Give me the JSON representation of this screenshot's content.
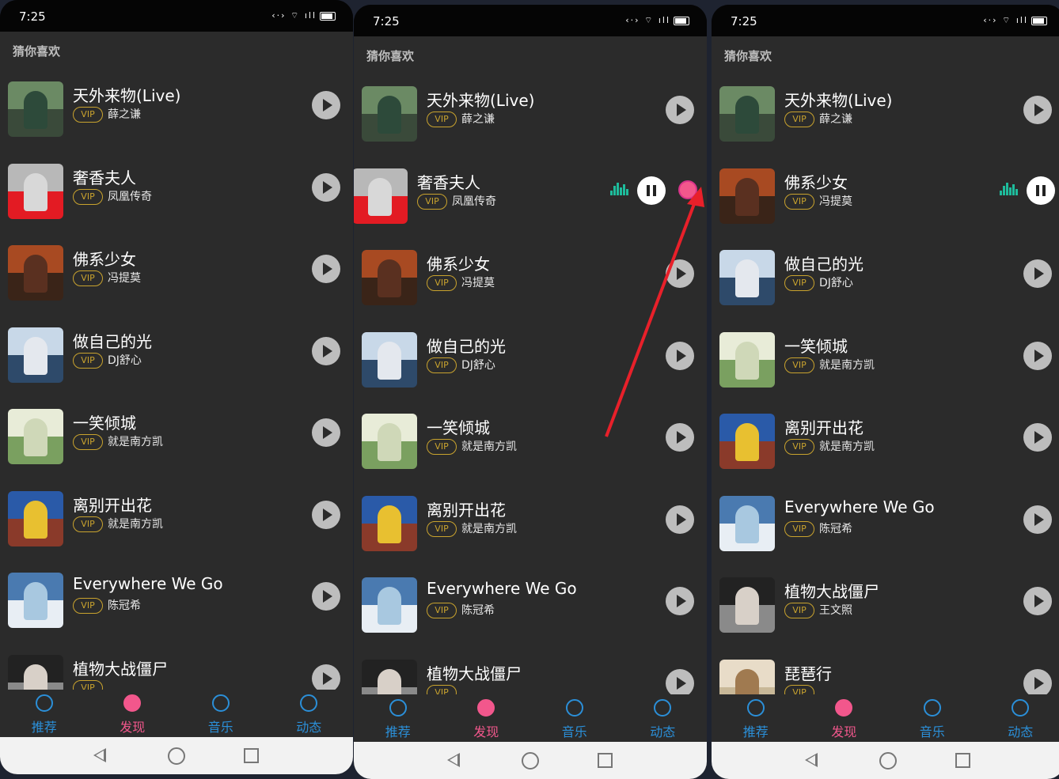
{
  "section_title": "猜你喜欢",
  "tabs": [
    {
      "label": "推荐",
      "icon": "thumbs-up-icon",
      "color": "#2b8fd8"
    },
    {
      "label": "发现",
      "icon": "discover-icon",
      "color": "#f2578c"
    },
    {
      "label": "音乐",
      "icon": "music-disc-icon",
      "color": "#2b8fd8"
    },
    {
      "label": "动态",
      "icon": "broadcast-icon",
      "color": "#2b8fd8"
    }
  ],
  "vip_label": "VIP",
  "colors": {
    "accent_vip": "#c9a32e",
    "playing_wave": "#1ebc9c",
    "tab_blue": "#2b8fd8",
    "tab_pink": "#f2578c",
    "list_bg": "#2b2b2b",
    "annotation_arrow": "#e8202a"
  },
  "screens": [
    {
      "time": "7:25",
      "songs": [
        {
          "title": "天外来物(Live)",
          "artist": "薛之谦",
          "state": "play"
        },
        {
          "title": "奢香夫人",
          "artist": "凤凰传奇",
          "state": "play"
        },
        {
          "title": "佛系少女",
          "artist": "冯提莫",
          "state": "play"
        },
        {
          "title": "做自己的光",
          "artist": "DJ舒心",
          "state": "play"
        },
        {
          "title": "一笑倾城",
          "artist": "就是南方凯",
          "state": "play"
        },
        {
          "title": "离别开出花",
          "artist": "就是南方凯",
          "state": "play"
        },
        {
          "title": "Everywhere We Go",
          "artist": "陈冠希",
          "state": "play"
        },
        {
          "title": "植物大战僵尸",
          "artist": "",
          "state": "play"
        }
      ]
    },
    {
      "time": "7:25",
      "songs": [
        {
          "title": "天外来物(Live)",
          "artist": "薛之谦",
          "state": "play"
        },
        {
          "title": "奢香夫人",
          "artist": "凤凰传奇",
          "state": "playing-swiped"
        },
        {
          "title": "佛系少女",
          "artist": "冯提莫",
          "state": "play"
        },
        {
          "title": "做自己的光",
          "artist": "DJ舒心",
          "state": "play"
        },
        {
          "title": "一笑倾城",
          "artist": "就是南方凯",
          "state": "play"
        },
        {
          "title": "离别开出花",
          "artist": "就是南方凯",
          "state": "play"
        },
        {
          "title": "Everywhere We Go",
          "artist": "陈冠希",
          "state": "play"
        },
        {
          "title": "植物大战僵尸",
          "artist": "",
          "state": "play"
        }
      ]
    },
    {
      "time": "7:25",
      "songs": [
        {
          "title": "天外来物(Live)",
          "artist": "薛之谦",
          "state": "play"
        },
        {
          "title": "佛系少女",
          "artist": "冯提莫",
          "state": "playing"
        },
        {
          "title": "做自己的光",
          "artist": "DJ舒心",
          "state": "play"
        },
        {
          "title": "一笑倾城",
          "artist": "就是南方凯",
          "state": "play"
        },
        {
          "title": "离别开出花",
          "artist": "就是南方凯",
          "state": "play"
        },
        {
          "title": "Everywhere We Go",
          "artist": "陈冠希",
          "state": "play"
        },
        {
          "title": "植物大战僵尸",
          "artist": "王文照",
          "state": "play"
        },
        {
          "title": "琵琶行",
          "artist": "",
          "state": "play"
        }
      ]
    }
  ]
}
